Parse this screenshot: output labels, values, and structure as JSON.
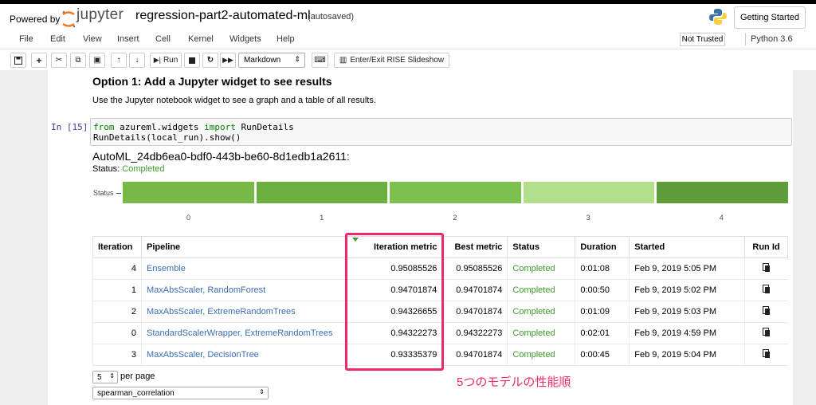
{
  "header": {
    "powered_by": "Powered by",
    "logo_text": "jupyter",
    "notebook_name": "regression-part2-automated-ml",
    "autosaved": "(autosaved)",
    "getting_started": "Getting Started"
  },
  "menu": {
    "items": [
      "File",
      "Edit",
      "View",
      "Insert",
      "Cell",
      "Kernel",
      "Widgets",
      "Help"
    ],
    "trust": "Not Trusted",
    "kernel": "Python 3.6"
  },
  "toolbar": {
    "run_label": "Run",
    "cell_type": "Markdown",
    "rise_label": "Enter/Exit RISE Slideshow"
  },
  "markdown": {
    "heading": "Option 1: Add a Jupyter widget to see results",
    "paragraph": "Use the Jupyter notebook widget to see a graph and a table of all results."
  },
  "code_cell": {
    "prompt": "In [15]:",
    "line1_kw1": "from",
    "line1_mod": " azureml.widgets ",
    "line1_kw2": "import",
    "line1_name": " RunDetails",
    "line2": "RunDetails(local_run).show()"
  },
  "output": {
    "run_title": "AutoML_24db6ea0-bdf0-443b-be60-8d1edb1a2611:",
    "status_prefix": "Status: ",
    "status_value": "Completed",
    "status_axis_label": "Status",
    "status_bar_ticks": [
      "0",
      "1",
      "2",
      "3",
      "4"
    ],
    "status_bar_colors": [
      "#76b947",
      "#6aaf3f",
      "#7cc04f",
      "#b2df8a",
      "#5d9e3a"
    ]
  },
  "table": {
    "columns": [
      "Iteration",
      "Pipeline",
      "Iteration metric",
      "Best metric",
      "Status",
      "Duration",
      "Started",
      "Run Id"
    ],
    "rows": [
      {
        "iteration": "4",
        "pipeline": "Ensemble",
        "metric": "0.95085526",
        "best": "0.95085526",
        "status": "Completed",
        "duration": "0:01:08",
        "started": "Feb 9, 2019 5:05 PM"
      },
      {
        "iteration": "1",
        "pipeline": "MaxAbsScaler, RandomForest",
        "metric": "0.94701874",
        "best": "0.94701874",
        "status": "Completed",
        "duration": "0:00:50",
        "started": "Feb 9, 2019 5:02 PM"
      },
      {
        "iteration": "2",
        "pipeline": "MaxAbsScaler, ExtremeRandomTrees",
        "metric": "0.94326655",
        "best": "0.94701874",
        "status": "Completed",
        "duration": "0:01:09",
        "started": "Feb 9, 2019 5:03 PM"
      },
      {
        "iteration": "0",
        "pipeline": "StandardScalerWrapper, ExtremeRandomTrees",
        "metric": "0.94322273",
        "best": "0.94322273",
        "status": "Completed",
        "duration": "0:02:01",
        "started": "Feb 9, 2019 4:59 PM"
      },
      {
        "iteration": "3",
        "pipeline": "MaxAbsScaler, DecisionTree",
        "metric": "0.93335379",
        "best": "0.94701874",
        "status": "Completed",
        "duration": "0:00:45",
        "started": "Feb 9, 2019 5:04 PM"
      }
    ]
  },
  "pagination": {
    "page_size": "5",
    "per_page_label": "per page",
    "metric_select": "spearman_correlation"
  },
  "annotation": {
    "text": "5つのモデルの性能順",
    "color": "#ec2a6b"
  }
}
